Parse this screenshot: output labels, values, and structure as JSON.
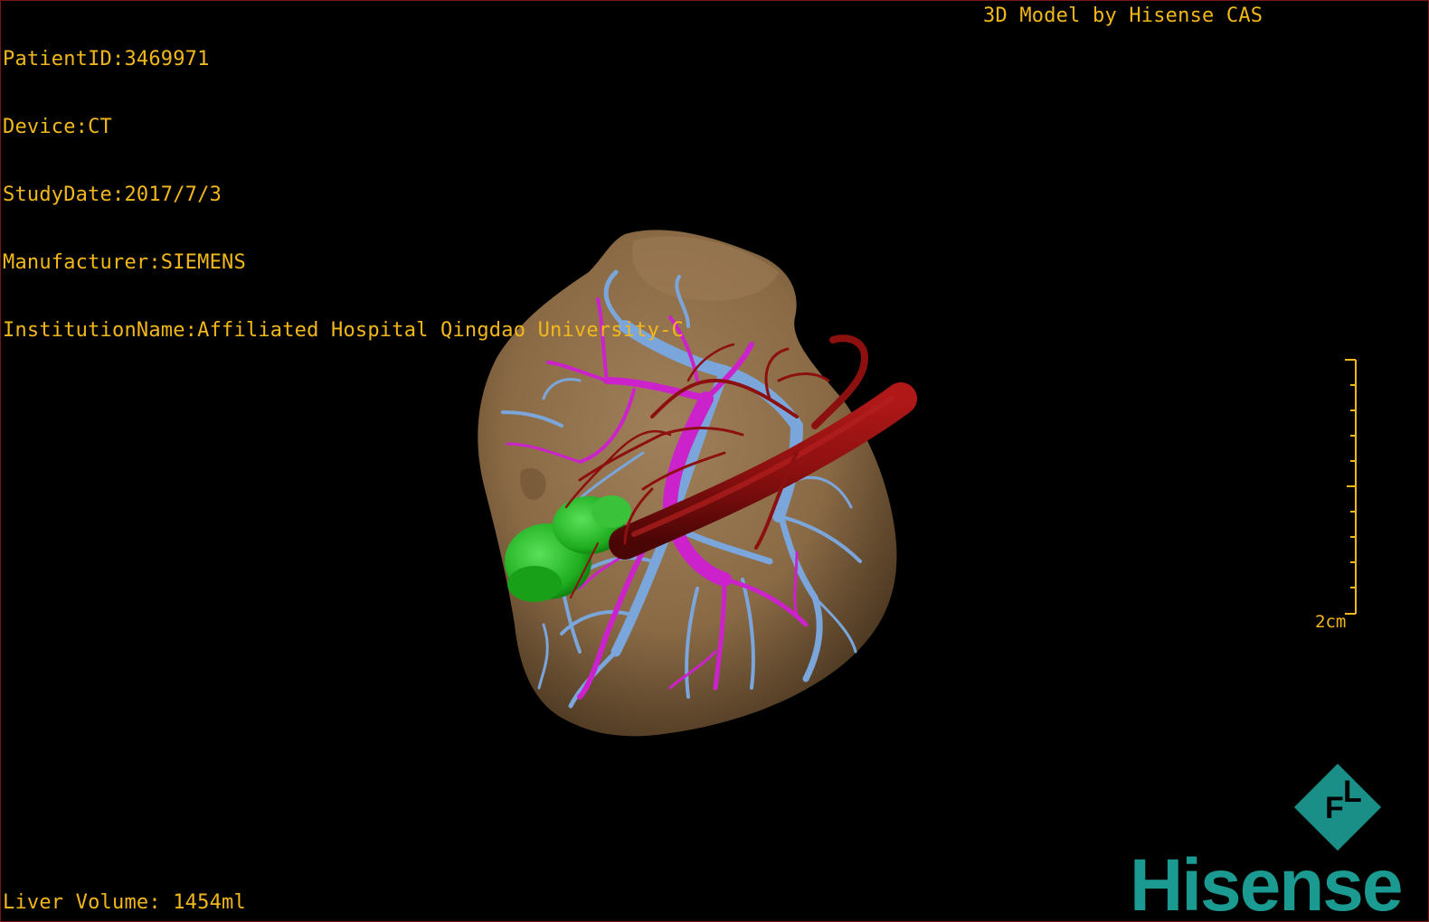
{
  "metadata": {
    "patient_id": "PatientID:3469971",
    "device": "Device:CT",
    "study_date": "StudyDate:2017/7/3",
    "manufacturer": "Manufacturer:SIEMENS",
    "institution": "InstitutionName:Affiliated Hospital Qingdao University-C"
  },
  "credit": "3D Model by Hisense CAS",
  "liver_volume": "Liver Volume: 1454ml",
  "scale_bar": {
    "label": "2cm"
  },
  "logo": {
    "brand": "Hisense",
    "badge": "FL"
  },
  "colors": {
    "overlay_text": "#f2b81a",
    "liver": "#8a6a45",
    "portal_vein": "#7aa6dc",
    "hepatic_vein": "#cc22cc",
    "artery": "#8c1010",
    "tumor": "#22b022",
    "brand": "#1a9a90"
  },
  "structures": [
    "liver",
    "portal-vein",
    "hepatic-vein",
    "hepatic-artery",
    "tumor"
  ]
}
